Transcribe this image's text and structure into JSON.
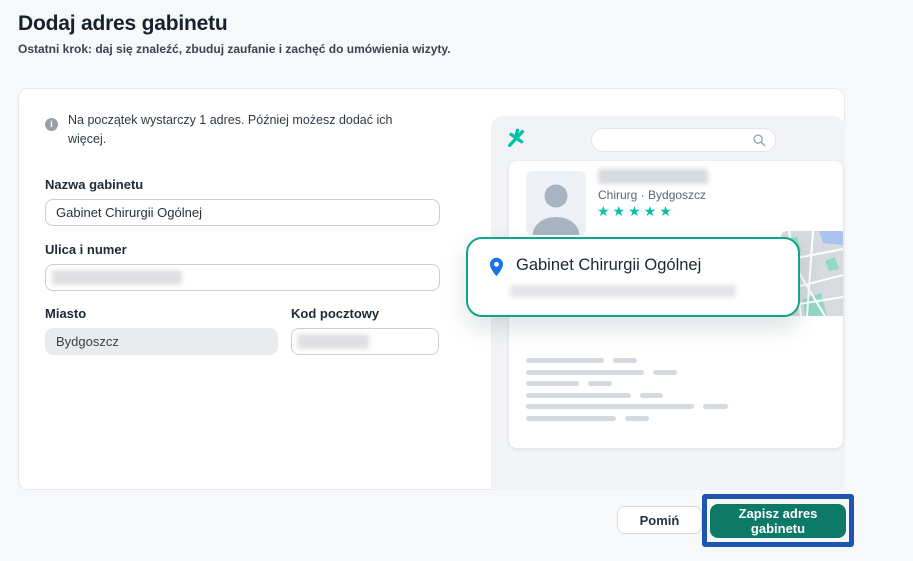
{
  "header": {
    "title": "Dodaj adres gabinetu",
    "subtitle": "Ostatni krok: daj się znaleźć, zbuduj zaufanie i zachęć do umówienia wizyty."
  },
  "info_banner": {
    "icon": "info-circle-icon",
    "text": "Na początek wystarczy 1 adres. Później możesz dodać ich więcej."
  },
  "form": {
    "office_name": {
      "label": "Nazwa gabinetu",
      "value": "Gabinet Chirurgii Ogólnej"
    },
    "street": {
      "label": "Ulica i numer",
      "value": ""
    },
    "city": {
      "label": "Miasto",
      "value": "Bydgoszcz"
    },
    "postal_code": {
      "label": "Kod pocztowy",
      "value": ""
    }
  },
  "preview": {
    "logo_icon": "docplanner-asterisk",
    "search_icon": "magnifier",
    "profile": {
      "specialty_location": "Chirurg · Bydgoszcz",
      "stars": "★★★★★",
      "rating_count": 5
    },
    "callout": {
      "pin_icon": "location-pin",
      "office_name": "Gabinet Chirurgii Ogólnej"
    }
  },
  "actions": {
    "skip_label": "Pomiń",
    "save_label": "Zapisz adres gabinetu"
  },
  "colors": {
    "brand_teal": "#00c3a5",
    "callout_border_teal": "#12a38c",
    "save_button_teal": "#0d7a67",
    "highlight_blue": "#1d55b0",
    "pin_blue": "#1a73e8",
    "page_background": "#f7f8fa"
  }
}
